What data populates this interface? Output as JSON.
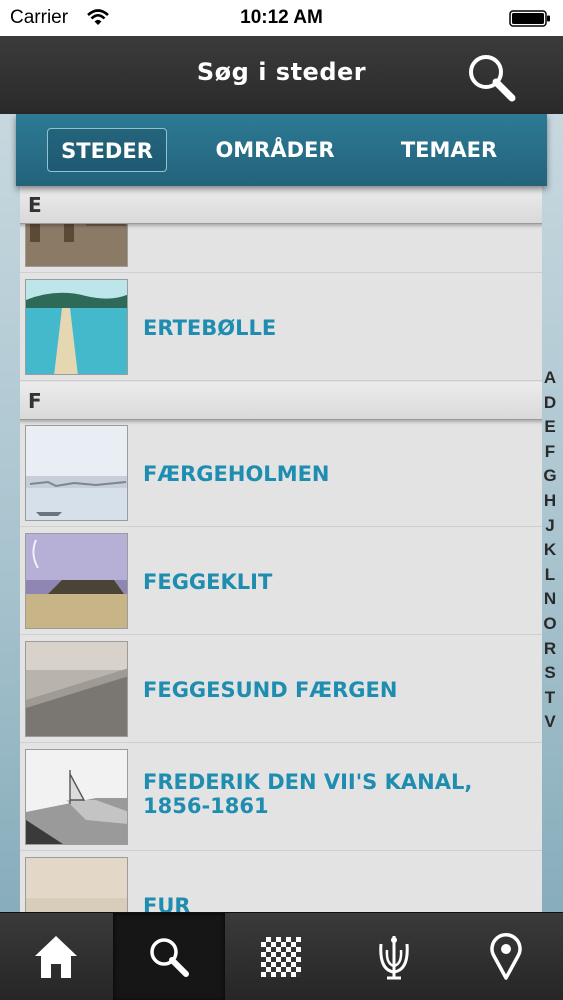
{
  "status_bar": {
    "carrier": "Carrier",
    "time": "10:12 AM"
  },
  "nav": {
    "title": "Søg i steder"
  },
  "tabs": [
    {
      "label": "STEDER",
      "active": true
    },
    {
      "label": "OMRÅDER",
      "active": false
    },
    {
      "label": "TEMAER",
      "active": false
    }
  ],
  "sections": [
    {
      "letter": "E",
      "items": [
        "",
        "ERTEBØLLE"
      ]
    },
    {
      "letter": "F",
      "items": [
        "FÆRGEHOLMEN",
        "FEGGEKLIT",
        "FEGGESUND FÆRGEN",
        "FREDERIK DEN VII'S KANAL, 1856-1861",
        "FUR"
      ]
    }
  ],
  "alphabet_index": [
    "A",
    "D",
    "E",
    "F",
    "G",
    "H",
    "J",
    "K",
    "L",
    "N",
    "O",
    "R",
    "S",
    "T",
    "V"
  ],
  "bottom_tabs": [
    {
      "icon": "home-icon",
      "selected": false
    },
    {
      "icon": "search-icon",
      "selected": true
    },
    {
      "icon": "qr-code-icon",
      "selected": false
    },
    {
      "icon": "trident-icon",
      "selected": false
    },
    {
      "icon": "map-pin-icon",
      "selected": false
    }
  ],
  "colors": {
    "accent": "#1f8db0",
    "tab_bar": "#2a7089",
    "nav_bar": "#2f2f2f"
  }
}
